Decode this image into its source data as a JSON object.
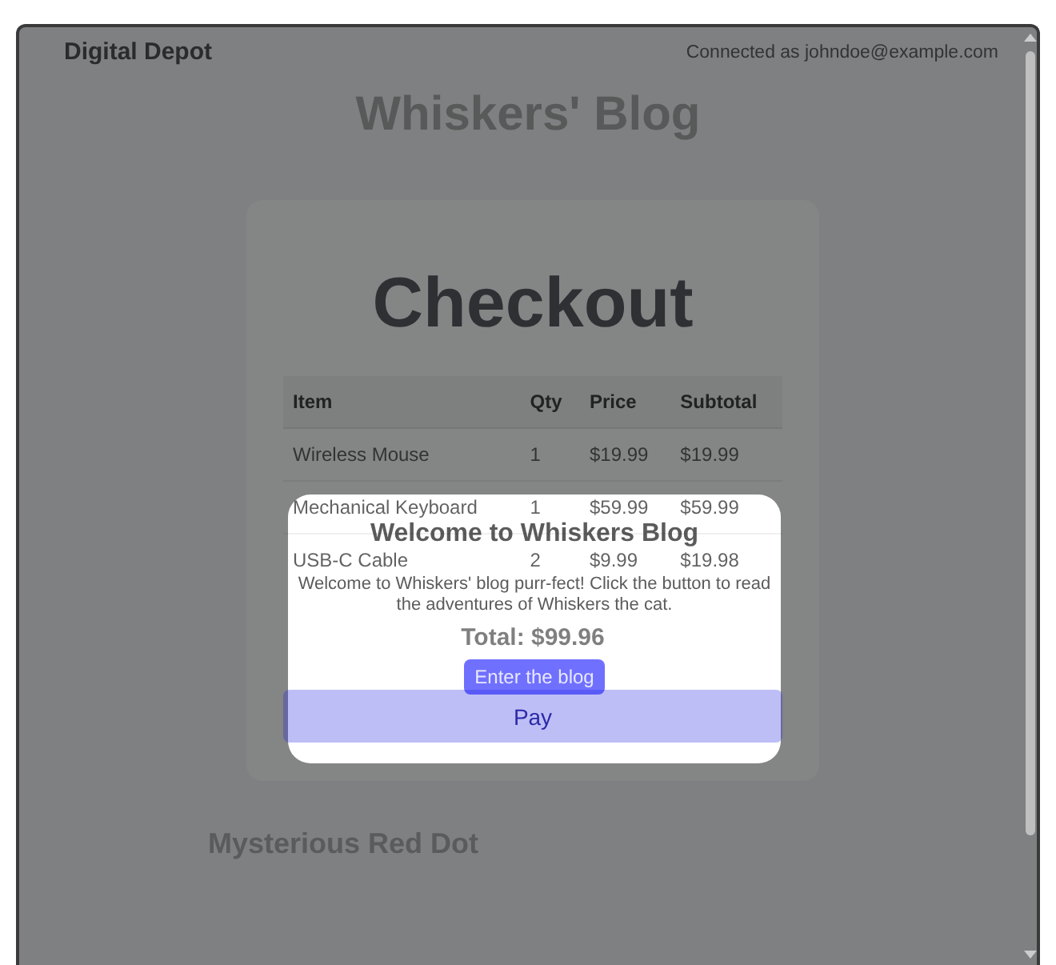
{
  "header": {
    "brand": "Digital Depot",
    "account": "Connected as johndoe@example.com"
  },
  "blog": {
    "title": "Whiskers' Blog",
    "posts": [
      {
        "title": "Mysterious Red Dot"
      }
    ]
  },
  "checkout": {
    "title": "Checkout",
    "columns": [
      "Item",
      "Qty",
      "Price",
      "Subtotal"
    ],
    "rows": [
      [
        "Wireless Mouse",
        "1",
        "$19.99",
        "$19.99"
      ],
      [
        "Mechanical Keyboard",
        "1",
        "$59.99",
        "$59.99"
      ],
      [
        "USB-C Cable",
        "2",
        "$9.99",
        "$19.98"
      ]
    ],
    "total": "Total: $99.96",
    "pay_button": "Pay"
  },
  "modal": {
    "title": "Welcome to Whiskers Blog",
    "message": "Welcome to Whiskers' blog purr-fect! Click the button to read the adventures of Whiskers the cat.",
    "button": "Enter the blog"
  }
}
